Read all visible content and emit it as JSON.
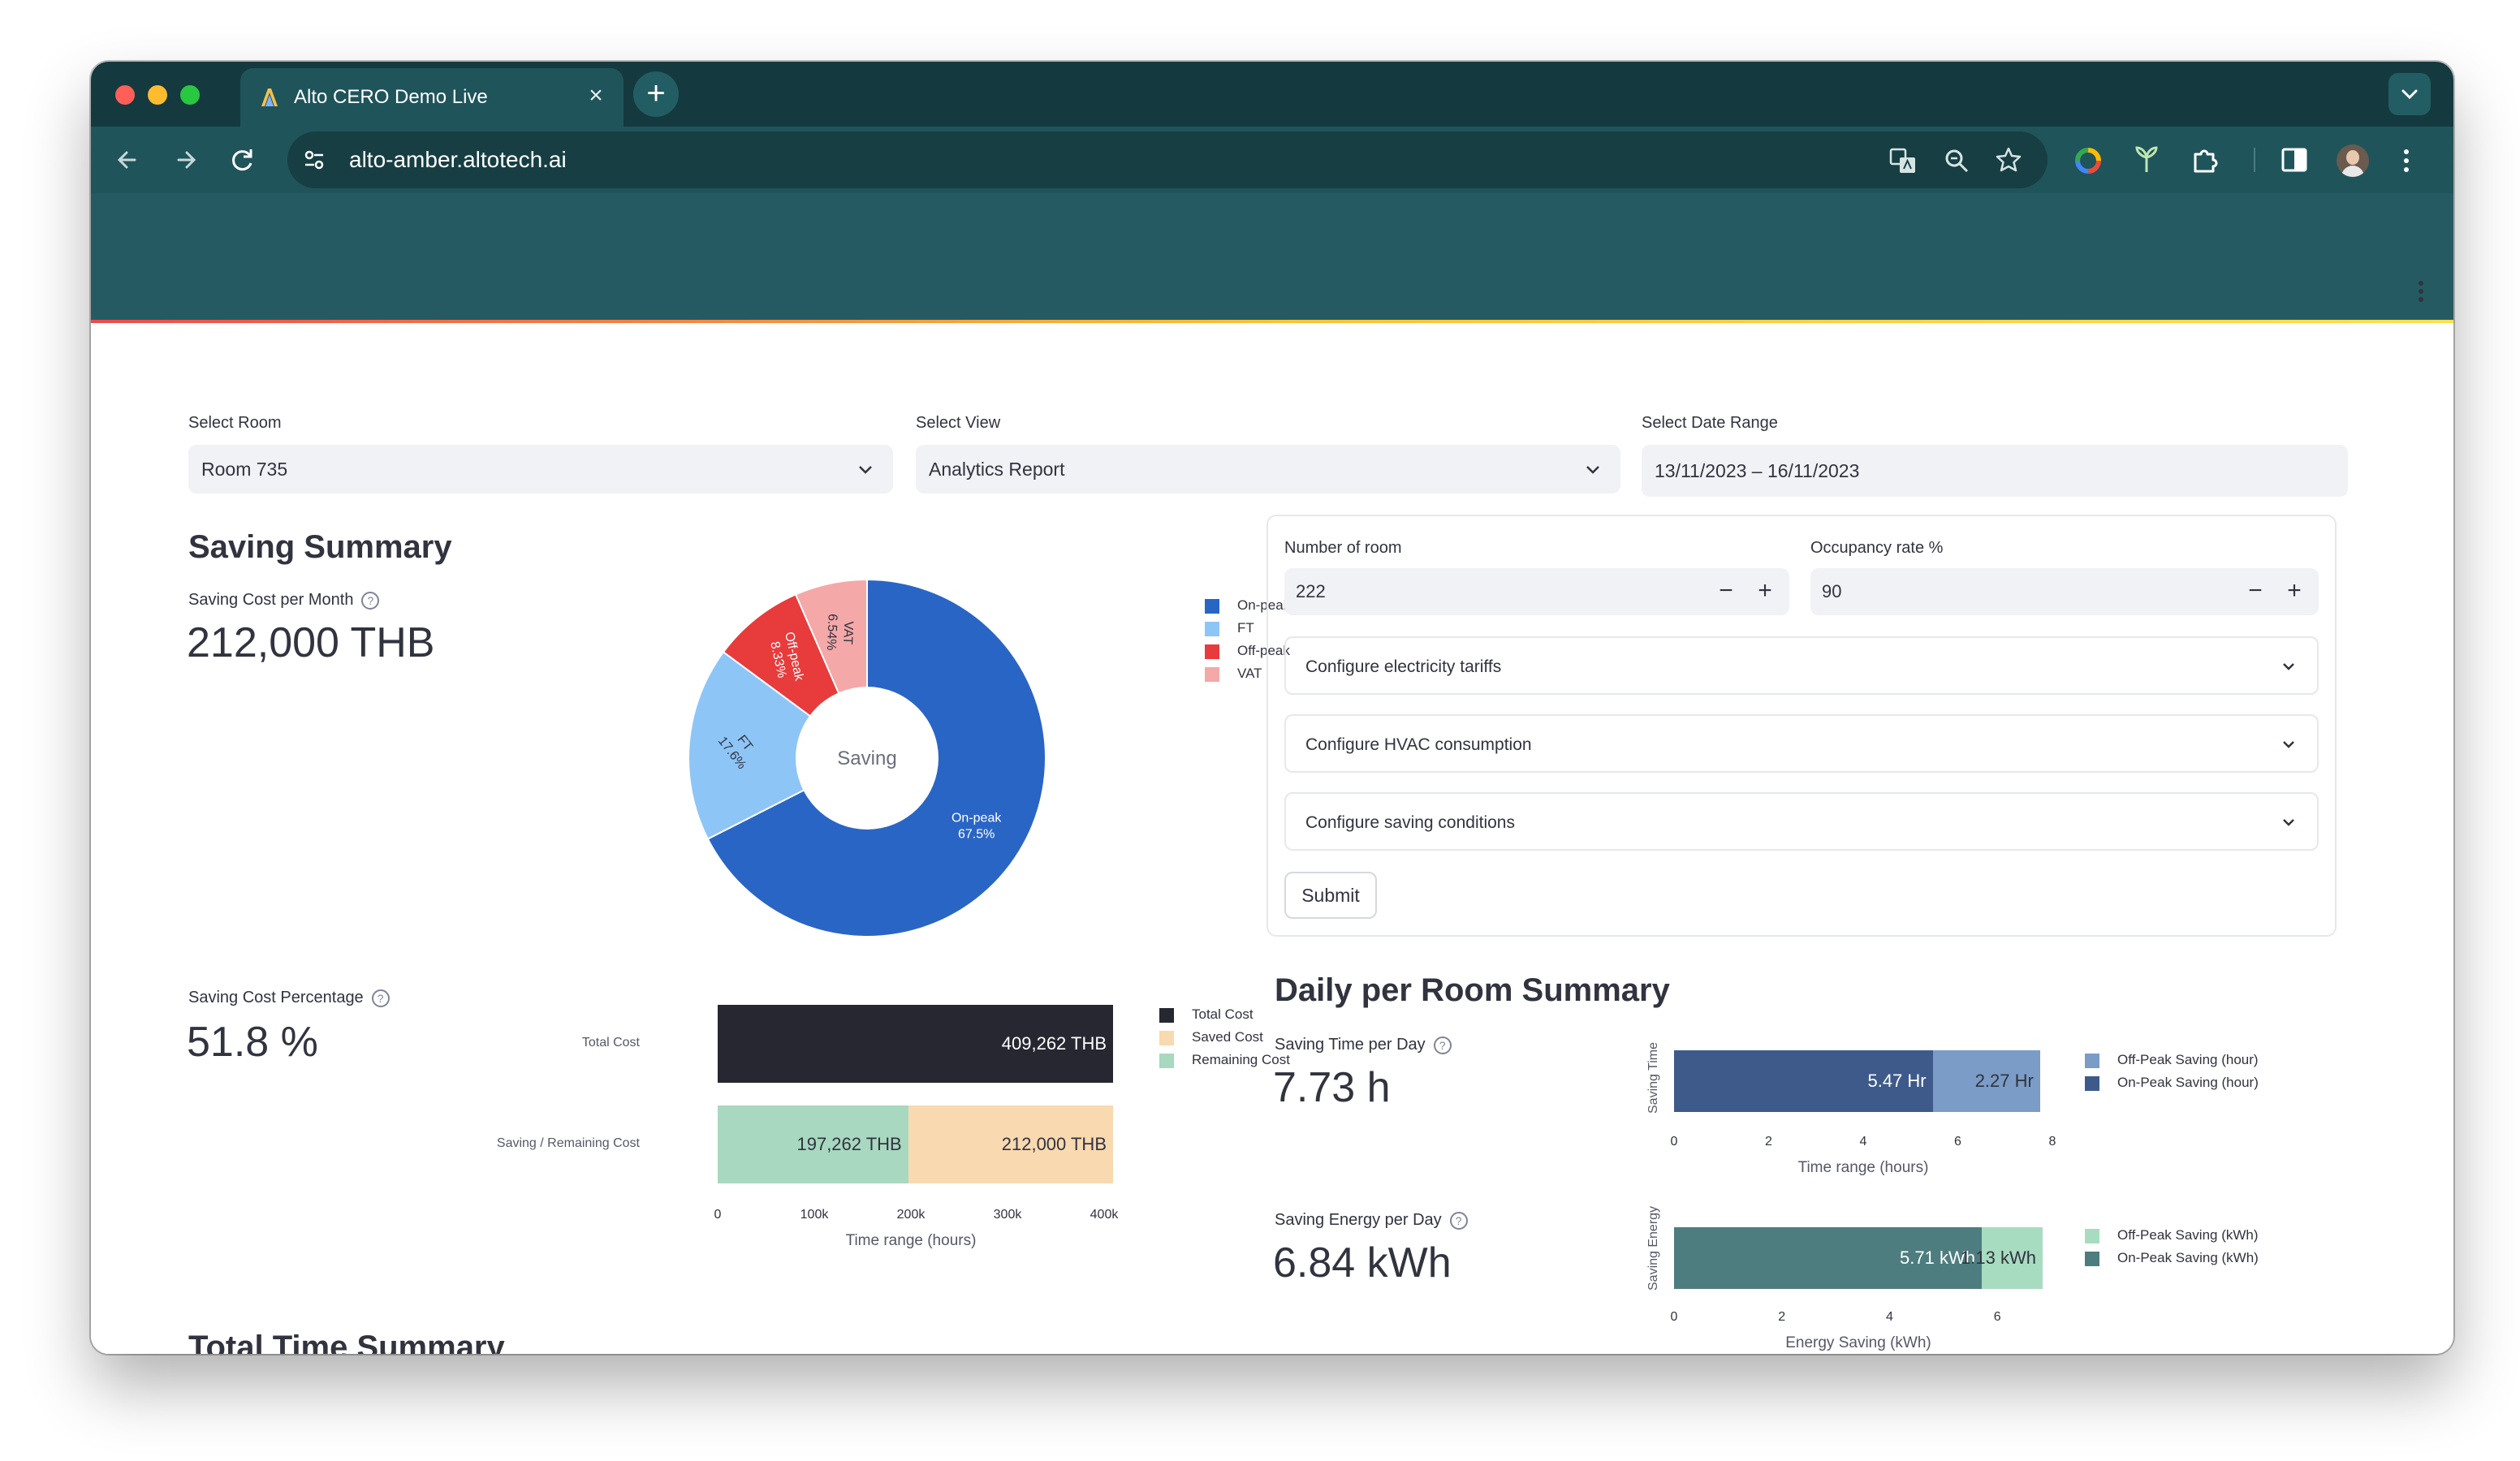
{
  "browser": {
    "tab_title": "Alto CERO Demo Live",
    "url": "alto-amber.altotech.ai",
    "colors": {
      "frame": "#14393f",
      "toolbar": "#1f545b",
      "header": "#255a62"
    }
  },
  "filters": {
    "room": {
      "label": "Select Room",
      "value": "Room 735"
    },
    "view": {
      "label": "Select View",
      "value": "Analytics Report"
    },
    "date": {
      "label": "Select Date Range",
      "value": "13/11/2023 – 16/11/2023"
    }
  },
  "saving_summary": {
    "title": "Saving Summary",
    "cost_label": "Saving Cost per Month",
    "cost_value": "212,000 THB",
    "percent_label": "Saving Cost Percentage",
    "percent_value": "51.8 %"
  },
  "config": {
    "rooms_label": "Number of room",
    "rooms_value": "222",
    "occupancy_label": "Occupancy rate %",
    "occupancy_value": "90",
    "tariffs": "Configure electricity tariffs",
    "hvac": "Configure HVAC consumption",
    "conditions": "Configure saving conditions",
    "submit": "Submit"
  },
  "daily": {
    "title": "Daily per Room Summary",
    "time_label": "Saving Time per Day",
    "time_value": "7.73 h",
    "energy_label": "Saving Energy per Day",
    "energy_value": "6.84 kWh"
  },
  "total_time": {
    "title": "Total Time Summary"
  },
  "chart_data": [
    {
      "type": "pie",
      "center_label": "Saving",
      "slices": [
        {
          "name": "On-peak",
          "value": 67.5,
          "label": "67.5%",
          "color": "#2965c5"
        },
        {
          "name": "FT",
          "value": 17.6,
          "label": "17.6%",
          "color": "#8ec5f7"
        },
        {
          "name": "Off-peak",
          "value": 8.33,
          "label": "8.33%",
          "color": "#e83b3b"
        },
        {
          "name": "VAT",
          "value": 6.54,
          "label": "6.54%",
          "color": "#f4a8a8"
        }
      ]
    },
    {
      "type": "bar",
      "orientation": "horizontal",
      "stacked": true,
      "categories": [
        "Total Cost",
        "Saving / Remaining Cost"
      ],
      "series": [
        {
          "name": "Total Cost",
          "values": [
            409262,
            0
          ],
          "labels": [
            "409,262 THB",
            ""
          ],
          "color": "#262730"
        },
        {
          "name": "Remaining Cost",
          "values": [
            0,
            197262
          ],
          "labels": [
            "",
            "197,262 THB"
          ],
          "color": "#a8d8c0"
        },
        {
          "name": "Saved Cost",
          "values": [
            0,
            212000
          ],
          "labels": [
            "",
            "212,000 THB"
          ],
          "color": "#f9d9b0"
        }
      ],
      "legend": [
        "Total Cost",
        "Saved Cost",
        "Remaining Cost"
      ],
      "xlim": [
        0,
        400000
      ],
      "xticks": [
        "0",
        "100k",
        "200k",
        "300k",
        "400k"
      ],
      "xlabel": "Time range (hours)"
    },
    {
      "type": "bar",
      "orientation": "horizontal",
      "stacked": true,
      "categories": [
        ""
      ],
      "series": [
        {
          "name": "On-Peak Saving (hour)",
          "values": [
            5.47
          ],
          "labels": [
            "5.47 Hr"
          ],
          "color": "#3e5a8a"
        },
        {
          "name": "Off-Peak Saving (hour)",
          "values": [
            2.27
          ],
          "labels": [
            "2.27 Hr"
          ],
          "color": "#7a9cc6"
        }
      ],
      "legend": [
        "Off-Peak Saving (hour)",
        "On-Peak Saving (hour)"
      ],
      "xlim": [
        0,
        8
      ],
      "xticks": [
        "0",
        "2",
        "4",
        "6",
        "8"
      ],
      "xlabel": "Time range (hours)",
      "ylabel": "Saving Time"
    },
    {
      "type": "bar",
      "orientation": "horizontal",
      "stacked": true,
      "categories": [
        ""
      ],
      "series": [
        {
          "name": "On-Peak Saving (kWh)",
          "values": [
            5.71
          ],
          "labels": [
            "5.71 kWh"
          ],
          "color": "#4e7d7f"
        },
        {
          "name": "Off-Peak Saving (kWh)",
          "values": [
            1.13
          ],
          "labels": [
            "1.13 kWh"
          ],
          "color": "#a8dcc0"
        }
      ],
      "legend": [
        "Off-Peak Saving (kWh)",
        "On-Peak Saving (kWh)"
      ],
      "xlim": [
        0,
        6.84
      ],
      "xticks": [
        "0",
        "2",
        "4",
        "6"
      ],
      "xlabel": "Energy Saving (kWh)",
      "ylabel": "Saving Energy"
    }
  ]
}
